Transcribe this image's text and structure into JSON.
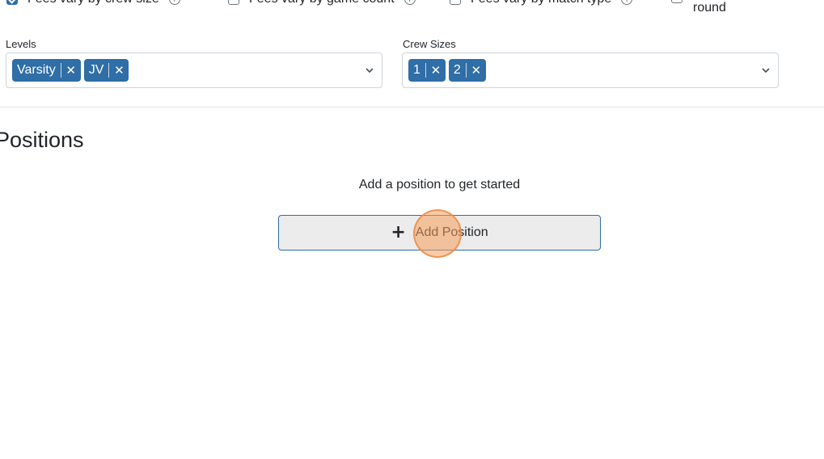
{
  "options": {
    "crew_size": {
      "label": "Fees vary by crew size",
      "checked": true
    },
    "game_count": {
      "label": "Fees vary by game count",
      "checked": false
    },
    "match_type": {
      "label": "Fees vary by match type",
      "checked": false
    },
    "round": {
      "label": "round",
      "checked": false
    }
  },
  "levels": {
    "label": "Levels",
    "chips": [
      "Varsity",
      "JV"
    ]
  },
  "crew_sizes": {
    "label": "Crew Sizes",
    "chips": [
      "1",
      "2"
    ]
  },
  "positions": {
    "title": "Positions",
    "empty_message": "Add a position to get started",
    "add_button_label": "Add Position",
    "add_icon": "plus-icon"
  },
  "colors": {
    "chip_bg": "#2f6ea6",
    "button_bg": "#ececec",
    "cursor_highlight": "#f59e5b"
  }
}
